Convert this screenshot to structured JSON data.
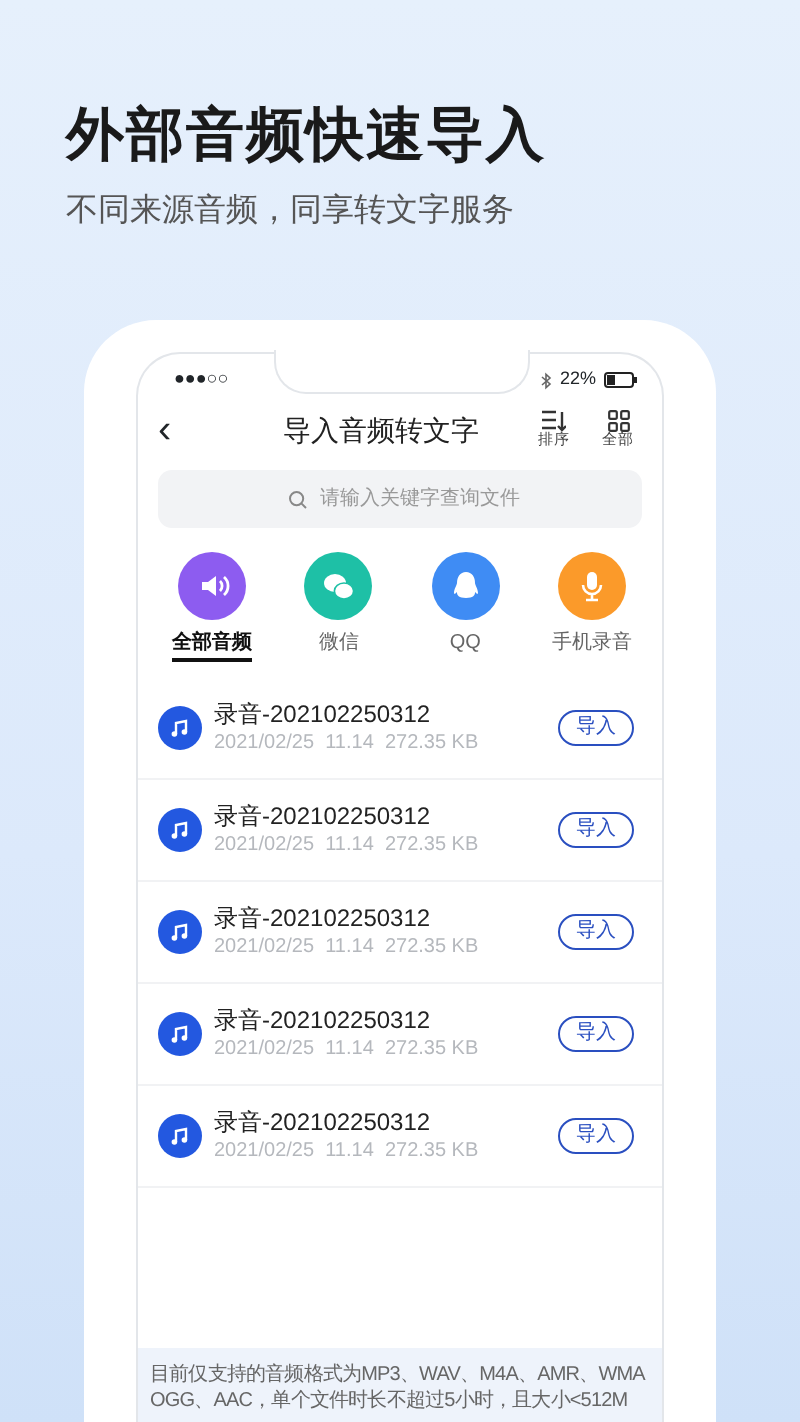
{
  "headline": "外部音频快速导入",
  "subtitle": "不同来源音频，同享转文字服务",
  "status_bar": {
    "signal": "●●●○○",
    "battery": "22%"
  },
  "nav": {
    "back": "‹",
    "title": "导入音频转文字",
    "actions": [
      {
        "kind": "sort",
        "label": "排序"
      },
      {
        "kind": "grid",
        "label": "全部"
      }
    ]
  },
  "search": {
    "placeholder": "请输入关键字查询文件"
  },
  "sources": [
    {
      "kind": "speaker",
      "label": "全部音频",
      "color": "#8d5cf0",
      "selected": true
    },
    {
      "kind": "chat",
      "label": "微信",
      "color": "#1ec0a6",
      "selected": false
    },
    {
      "kind": "penguin",
      "label": "QQ",
      "color": "#3f8cf4",
      "selected": false
    },
    {
      "kind": "mic",
      "label": "手机录音",
      "color": "#fb9a2a",
      "selected": false
    }
  ],
  "files": [
    {
      "name": "录音-202102250312",
      "meta": "2021/02/25  11.14  272.35 KB",
      "action": "导入"
    },
    {
      "name": "录音-202102250312",
      "meta": "2021/02/25  11.14  272.35 KB",
      "action": "导入"
    },
    {
      "name": "录音-202102250312",
      "meta": "2021/02/25  11.14  272.35 KB",
      "action": "导入"
    },
    {
      "name": "录音-202102250312",
      "meta": "2021/02/25  11.14  272.35 KB",
      "action": "导入"
    },
    {
      "name": "录音-202102250312",
      "meta": "2021/02/25  11.14  272.35 KB",
      "action": "导入"
    }
  ],
  "notice": {
    "lines": [
      "目前仅支持的音频格式为MP3、WAV、M4A、AMR、WMA",
      "OGG、AAC，单个文件时长不超过5小时，且大小<512M"
    ]
  }
}
